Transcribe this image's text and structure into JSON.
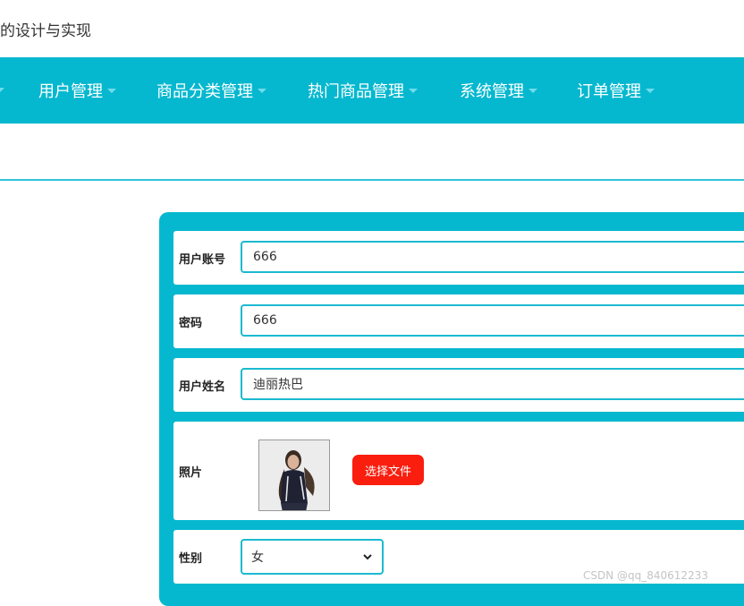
{
  "header": {
    "app_title": "的设计与实现"
  },
  "nav": {
    "items": [
      {
        "label": "用户管理"
      },
      {
        "label": "商品分类管理"
      },
      {
        "label": "热门商品管理"
      },
      {
        "label": "系统管理"
      },
      {
        "label": "订单管理"
      }
    ]
  },
  "form": {
    "account": {
      "label": "用户账号",
      "value": "666"
    },
    "password": {
      "label": "密码",
      "value": "666"
    },
    "name": {
      "label": "用户姓名",
      "value": "迪丽热巴"
    },
    "photo": {
      "label": "照片",
      "button_label": "选择文件"
    },
    "gender": {
      "label": "性别",
      "selected": "女"
    }
  },
  "watermark": "CSDN @qq_840612233",
  "colors": {
    "accent": "#06b8cf",
    "file_button": "#f91e0e"
  }
}
